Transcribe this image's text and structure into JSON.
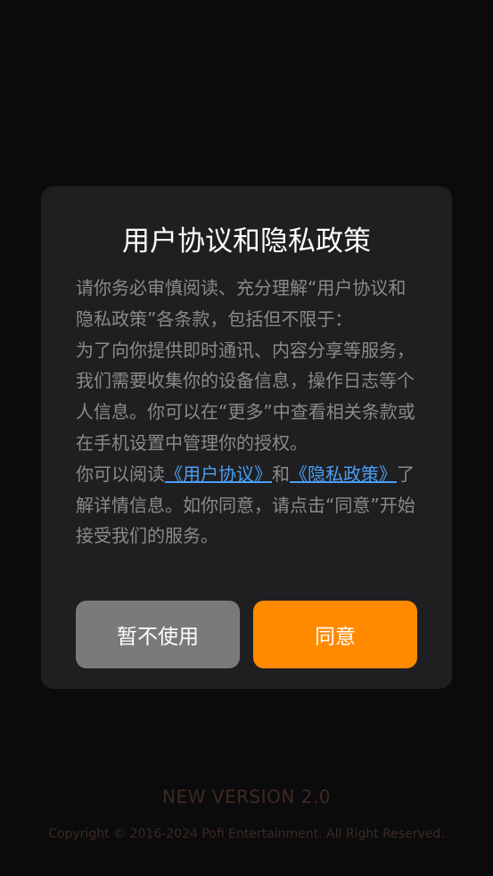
{
  "dialog": {
    "title": "用户协议和隐私政策",
    "paragraph1": "请你务必审慎阅读、充分理解“用户协议和隐私政策”各条款，包括但不限于：",
    "paragraph2": "为了向你提供即时通讯、内容分享等服务，我们需要收集你的设备信息，操作日志等个人信息。你可以在“更多”中查看相关条款或在手机设置中管理你的授权。",
    "paragraph3_prefix": "你可以阅读",
    "user_agreement_link": "《用户协议》",
    "conjunction": "和",
    "privacy_policy_link": "《隐私政策》",
    "paragraph3_suffix": "了解详情信息。如你同意，请点击“同意”开始接受我们的服务。",
    "decline_label": "暂不使用",
    "agree_label": "同意"
  },
  "footer": {
    "version": "NEW VERSION 2.0",
    "copyright": "Copyright © 2016-2024 Pofi Entertainment. All Right Reserved."
  },
  "colors": {
    "background": "#0b0b0c",
    "dialog_bg": "#1f1f21",
    "accent": "#ff8a00",
    "link": "#4a9ff5",
    "secondary_button": "#7a7a7c"
  }
}
